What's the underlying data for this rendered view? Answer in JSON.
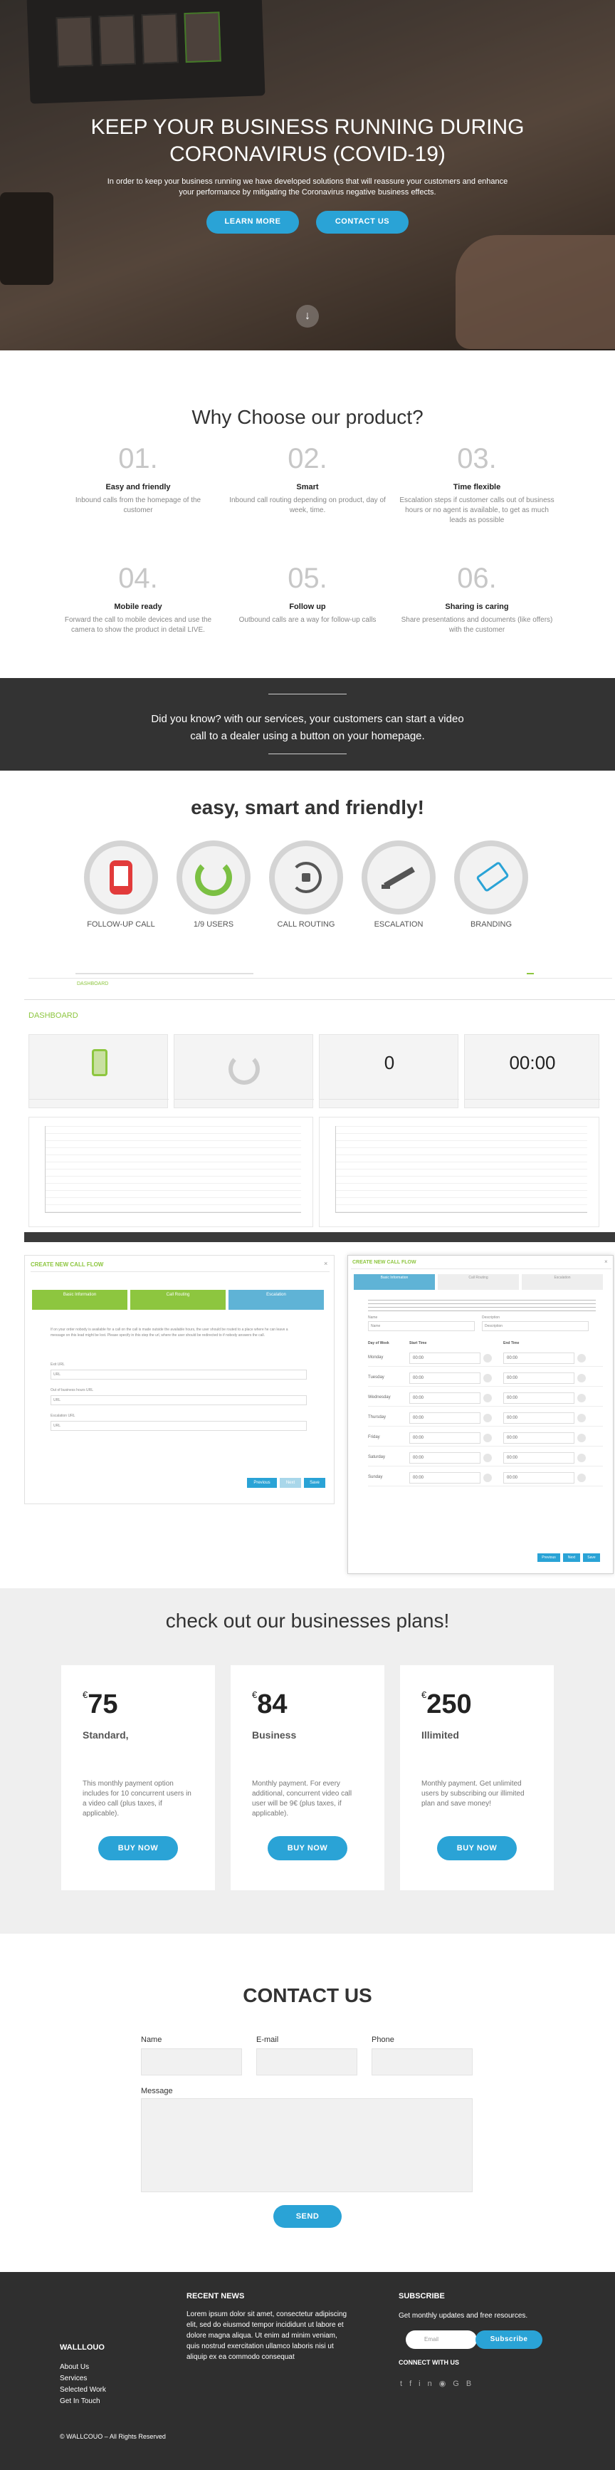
{
  "hero": {
    "title_line1": "KEEP YOUR BUSINESS RUNNING DURING",
    "title_line2": "CORONAVIRUS (COVID-19)",
    "subtitle": "In order to keep your business running we have developed solutions that will reassure your customers and enhance your performance by mitigating the Coronavirus negative business effects.",
    "learn_more": "LEARN MORE",
    "contact_us": "CONTACT US"
  },
  "why": {
    "title": "Why Choose our product?",
    "features": [
      {
        "num": "01.",
        "title": "Easy and friendly",
        "desc": "Inbound calls from the homepage of the customer"
      },
      {
        "num": "02.",
        "title": "Smart",
        "desc": "Inbound call routing depending on product, day of week, time."
      },
      {
        "num": "03.",
        "title": "Time flexible",
        "desc": "Escalation steps if customer calls out of business hours or no agent is available, to get as much leads as possible"
      },
      {
        "num": "04.",
        "title": "Mobile ready",
        "desc": "Forward the call to mobile devices and use the camera to show the product in detail LIVE."
      },
      {
        "num": "05.",
        "title": "Follow up",
        "desc": "Outbound calls are a way for follow-up calls"
      },
      {
        "num": "06.",
        "title": "Sharing is caring",
        "desc": "Share presentations and documents (like offers) with the customer"
      }
    ]
  },
  "did_you_know": {
    "line1": "Did you know? with our services, your customers can start a video",
    "line2": "call to a dealer using a button on your homepage."
  },
  "easy": {
    "title": "easy, smart and friendly!",
    "items": [
      {
        "label": "FOLLOW-UP CALL",
        "icon": "mobile-phone-icon"
      },
      {
        "label": "1/9 USERS",
        "icon": "gauge-users-icon"
      },
      {
        "label": "CALL ROUTING",
        "icon": "routing-icon"
      },
      {
        "label": "ESCALATION",
        "icon": "escalator-icon"
      },
      {
        "label": "BRANDING",
        "icon": "brand-tag-icon"
      }
    ]
  },
  "dashboard": {
    "header": "DASHBOARD",
    "title": "DASHBOARD",
    "stat_zero": "0",
    "stat_time": "00:00",
    "colors": {
      "accent": "#8dc63f",
      "blue": "#2aa3d6"
    }
  },
  "callflow_left": {
    "title": "CREATE NEW CALL FLOW",
    "steps": [
      "Basic Information",
      "Call Routing",
      "Escalation"
    ],
    "text": "If on your order nobody is available for a call on the call is made outside the available hours, the user should be routed to a place where he can leave a message on this lead might be lost. Please specify in this step the url, where the user should be redirected to if nobody answers the call.",
    "f1": "Exit URL",
    "f1_ph": "URL",
    "f2": "Out of business hours URL",
    "f2_ph": "URL",
    "f3": "Escalation URL",
    "f3_ph": "URL",
    "btns": [
      "Previous",
      "Next",
      "Save"
    ]
  },
  "callflow_right": {
    "title": "CREATE NEW CALL FLOW",
    "steps": [
      "Basic Information",
      "Call Routing",
      "Escalation"
    ],
    "name_label": "Name",
    "desc_label": "Description",
    "name_ph": "Name",
    "desc_ph": "Description",
    "col_day": "Day of Week",
    "col_start": "Start Time",
    "col_end": "End Time",
    "days": [
      "Monday",
      "Tuesday",
      "Wednesday",
      "Thursday",
      "Friday",
      "Saturday",
      "Sunday"
    ],
    "time": "00:00",
    "btns": [
      "Previous",
      "Next",
      "Save"
    ]
  },
  "plans": {
    "title": "check out our businesses plans!",
    "cards": [
      {
        "currency": "€",
        "price": "75",
        "name": "Standard,",
        "desc": "This monthly payment option includes for 10 concurrent users in a video call (plus taxes, if applicable).",
        "btn": "BUY NOW"
      },
      {
        "currency": "€",
        "price": "84",
        "name": "Business",
        "desc": "Monthly payment. For every additional, concurrent video call user will be 9€ (plus taxes, if applicable).",
        "btn": "BUY NOW"
      },
      {
        "currency": "€",
        "price": "250",
        "name": "Illimited",
        "desc": "Monthly payment. Get unlimited users by subscribing our illimited plan and save money!",
        "btn": "BUY NOW"
      }
    ]
  },
  "contact": {
    "title": "CONTACT US",
    "name_label": "Name",
    "email_label": "E-mail",
    "phone_label": "Phone",
    "message_label": "Message",
    "send": "SEND"
  },
  "footer": {
    "brand": "WALLLOUO",
    "links": [
      "About Us",
      "Services",
      "Selected Work",
      "Get In Touch"
    ],
    "news_title": "RECENT NEWS",
    "news_text": "Lorem ipsum dolor sit amet, consectetur adipiscing elit, sed do eiusmod tempor incididunt ut labore et dolore magna aliqua. Ut enim ad minim veniam, quis nostrud exercitation ullamco laboris nisi ut aliquip ex ea commodo consequat",
    "subscribe_title": "SUBSCRIBE",
    "subscribe_text": "Get monthly updates and free resources.",
    "email_ph": "Email",
    "subscribe_btn": "Subscribe",
    "connect": "CONNECT WITH US",
    "copyright": "© WALLCOUO – All Rights Reserved"
  }
}
